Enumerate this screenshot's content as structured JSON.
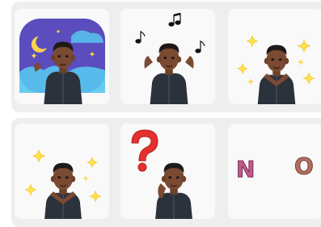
{
  "sticker_grid": {
    "rows": [
      {
        "stickers": [
          {
            "icon": "night-sky-wave-sticker-icon"
          },
          {
            "icon": "music-dance-sticker-icon"
          },
          {
            "icon": "sparkle-pose-sticker-icon"
          }
        ]
      },
      {
        "stickers": [
          {
            "icon": "sparkle-cheer-sticker-icon"
          },
          {
            "icon": "question-mark-thinking-sticker-icon"
          },
          {
            "icon": "no-bubble-letters-sticker-icon"
          }
        ]
      }
    ]
  },
  "text_art": {
    "no_letters": "NO"
  },
  "colors": {
    "panel_background": "#eeeeee",
    "tile_background": "#f9f9f9",
    "night_sky": "#5b4dbd",
    "cloud_blue": "#58c6ef",
    "moon_yellow": "#ffd24a",
    "sparkle_yellow": "#ffe14d",
    "question_red": "#e63030",
    "jacket": "#2b323b",
    "skin": "#7a4a32",
    "hair": "#1f1a17"
  }
}
